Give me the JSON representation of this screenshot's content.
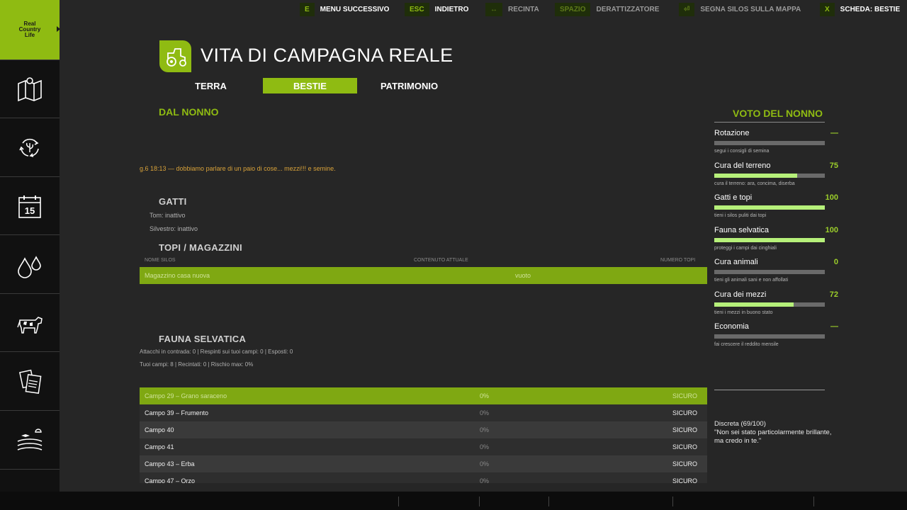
{
  "logo": {
    "line1": "Real",
    "line2": "Country",
    "line3": "Life"
  },
  "sidebar": {
    "items": [
      {
        "icon": "map-icon"
      },
      {
        "icon": "recycle-icon"
      },
      {
        "icon": "calendar-icon",
        "day": "15"
      },
      {
        "icon": "drops-icon"
      },
      {
        "icon": "cow-icon"
      },
      {
        "icon": "documents-icon"
      },
      {
        "icon": "fields-icon"
      },
      {
        "icon": "person-icon"
      }
    ]
  },
  "header": {
    "title": "VITA DI CAMPAGNA REALE"
  },
  "tabs": [
    {
      "label": "TERRA",
      "active": false
    },
    {
      "label": "BESTIE",
      "active": true
    },
    {
      "label": "PATRIMONIO",
      "active": false
    }
  ],
  "main": {
    "from_grandpa": "DAL NONNO",
    "message": "g.6  18:13  —  dobbiamo parlare di un paio di cose... mezzi!!! e semine.",
    "cats": {
      "title": "GATTI",
      "lines": [
        "Tom: inattivo",
        "Silvestro: inattivo"
      ]
    },
    "mice": {
      "title": "TOPI / MAGAZZINI",
      "col_name": "NOME SILOS",
      "col_content": "CONTENUTO ATTUALE",
      "col_mice": "NUMERO TOPI",
      "rows": [
        {
          "name": "Magazzino casa nuova",
          "content": "vuoto"
        }
      ]
    },
    "wildlife": {
      "title": "FAUNA SELVATICA",
      "stats1": "Attacchi in contrada: 0  |  Respinti sui tuoi campi: 0  |  Esposti: 0",
      "stats2": "Tuoi campi: 8  |  Recintati: 0  |  Rischio max: 0%",
      "fields": [
        {
          "name": "Campo 29 – Grano saraceno",
          "risk": "0%",
          "status": "SICURO"
        },
        {
          "name": "Campo 39 – Frumento",
          "risk": "0%",
          "status": "SICURO"
        },
        {
          "name": "Campo 40",
          "risk": "0%",
          "status": "SICURO"
        },
        {
          "name": "Campo 41",
          "risk": "0%",
          "status": "SICURO"
        },
        {
          "name": "Campo 43 – Erba",
          "risk": "0%",
          "status": "SICURO"
        },
        {
          "name": "Campo 47 – Orzo",
          "risk": "0%",
          "status": "SICURO"
        }
      ]
    }
  },
  "grades": {
    "title": "VOTO DEL NONNO",
    "items": [
      {
        "name": "Rotazione",
        "value": "—",
        "fill": 0,
        "hint": "segui i consigli di semina"
      },
      {
        "name": "Cura del terreno",
        "value": "75",
        "fill": 0.75,
        "hint": "cura il terreno: ara, concima, diserba"
      },
      {
        "name": "Gatti e topi",
        "value": "100",
        "fill": 1.0,
        "hint": "tieni i silos puliti dai topi"
      },
      {
        "name": "Fauna selvatica",
        "value": "100",
        "fill": 1.0,
        "hint": "proteggi i campi dai cinghiali"
      },
      {
        "name": "Cura animali",
        "value": "0",
        "fill": 0,
        "hint": "tieni gli animali sani e non affollati"
      },
      {
        "name": "Cura dei mezzi",
        "value": "72",
        "fill": 0.72,
        "hint": "tieni i mezzi in buono stato"
      },
      {
        "name": "Economia",
        "value": "—",
        "fill": 0,
        "hint": "fai crescere il reddito mensile"
      }
    ],
    "verdict_line1": "Discreta (69/100)",
    "verdict_line2": "\"Non sei stato particolarmente brillante, ma credo in te.\""
  },
  "bottombar": {
    "hints": [
      {
        "key": "E",
        "label": "MENU SUCCESSIVO",
        "dim": false
      },
      {
        "key": "ESC",
        "label": "INDIETRO",
        "dim": false
      },
      {
        "key": "↔",
        "label": "RECINTA",
        "dim": true
      },
      {
        "key": "SPAZIO",
        "label": "DERATTIZZATORE",
        "dim": true
      },
      {
        "key": "⏎",
        "label": "SEGNA SILOS SULLA MAPPA",
        "dim": true
      },
      {
        "key": "X",
        "label": "SCHEDA: BESTIE",
        "dim": false
      }
    ]
  },
  "colors": {
    "accent": "#8fbb12",
    "bar_fill": "#b6f07a",
    "message": "#d8a23a"
  }
}
